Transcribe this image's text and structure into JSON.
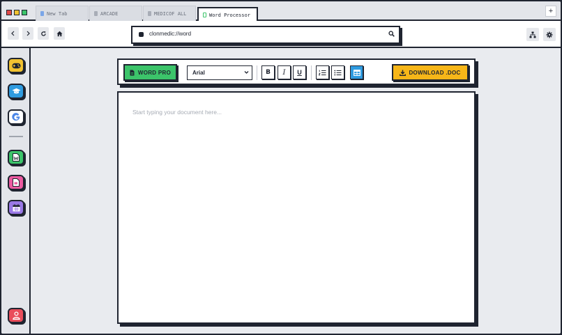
{
  "window": {
    "tabs": [
      {
        "label": "New Tab",
        "active": false
      },
      {
        "label": "ARCADE",
        "active": false
      },
      {
        "label": "MEDICOF ALL",
        "active": false
      },
      {
        "label": "Word Processor",
        "active": true
      }
    ],
    "new_tab_label": "+"
  },
  "address_bar": {
    "url": "clonmedic://word"
  },
  "toolbar": {
    "app_label": "WORD PRO",
    "font_selected": "Arial",
    "bold_label": "B",
    "italic_label": "I",
    "underline_label": "U",
    "download_label": "DOWNLOAD .DOC"
  },
  "editor": {
    "placeholder": "Start typing your document here..."
  },
  "sidebar": {
    "apps": [
      {
        "name": "gamepad",
        "color": "#f2c230"
      },
      {
        "name": "graduation-cap",
        "color": "#2f9be0"
      },
      {
        "name": "google",
        "color": "#ffffff"
      },
      {
        "name": "word-doc",
        "color": "#3cc46a"
      },
      {
        "name": "pdf-doc",
        "color": "#ec5aa0"
      },
      {
        "name": "calendar",
        "color": "#9a78e6"
      },
      {
        "name": "profile",
        "color": "#e94d5b"
      }
    ]
  },
  "colors": {
    "border": "#1f2430",
    "word_green": "#3cc46a",
    "download_yellow": "#f7b618",
    "table_blue": "#2f9be0"
  }
}
